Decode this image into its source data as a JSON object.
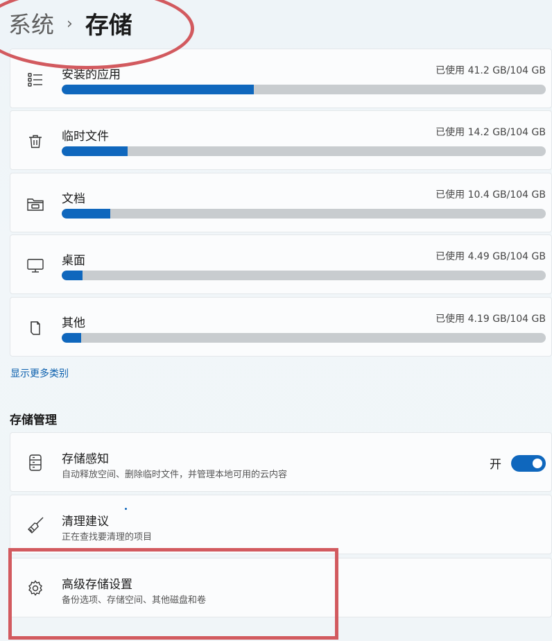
{
  "breadcrumb": {
    "parent": "系统",
    "separator": "›",
    "current": "存储"
  },
  "storage_items": [
    {
      "icon": "app-list-icon",
      "label": "安装的应用",
      "usage": "已使用 41.2 GB/104 GB",
      "used_gb": 41.2,
      "total_gb": 104
    },
    {
      "icon": "trash-icon",
      "label": "临时文件",
      "usage": "已使用 14.2 GB/104 GB",
      "used_gb": 14.2,
      "total_gb": 104
    },
    {
      "icon": "folder-icon",
      "label": "文档",
      "usage": "已使用 10.4 GB/104 GB",
      "used_gb": 10.4,
      "total_gb": 104
    },
    {
      "icon": "monitor-icon",
      "label": "桌面",
      "usage": "已使用 4.49 GB/104 GB",
      "used_gb": 4.49,
      "total_gb": 104
    },
    {
      "icon": "document-icon",
      "label": "其他",
      "usage": "已使用 4.19 GB/104 GB",
      "used_gb": 4.19,
      "total_gb": 104
    }
  ],
  "more_link": "显示更多类别",
  "management": {
    "title": "存储管理",
    "storage_sense": {
      "icon": "drive-icon",
      "label": "存储感知",
      "desc": "自动释放空间、删除临时文件，并管理本地可用的云内容",
      "toggle_state": "开",
      "toggle_on": true
    },
    "cleanup": {
      "icon": "broom-icon",
      "label": "清理建议",
      "desc": "正在查找要清理的项目"
    },
    "advanced": {
      "icon": "gear-icon",
      "label": "高级存储设置",
      "desc": "备份选项、存储空间、其他磁盘和卷"
    }
  },
  "colors": {
    "accent": "#0f67bd",
    "bar_track": "#c8cccf",
    "annotation": "#d25a5f"
  }
}
